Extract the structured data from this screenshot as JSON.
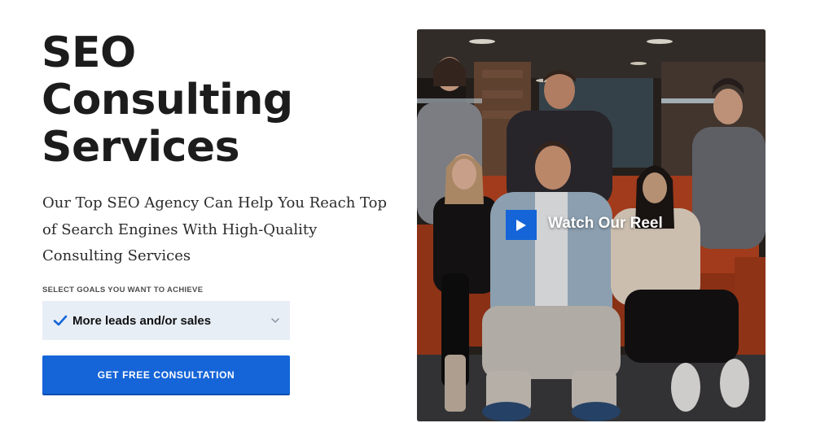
{
  "hero": {
    "title_lines": [
      "SEO",
      "Consulting",
      "Services"
    ],
    "subtitle": "Our Top SEO Agency Can Help You Reach Top of Search Engines With High-Quality Consulting Services"
  },
  "goals": {
    "label": "SELECT GOALS YOU WANT TO ACHIEVE",
    "selected": "More leads and/or sales",
    "icon": "checkmark-icon",
    "dropdown_icon": "chevron-down-icon"
  },
  "cta": {
    "label": "GET FREE CONSULTATION"
  },
  "video": {
    "label": "Watch Our Reel",
    "icon": "play-icon"
  },
  "colors": {
    "accent": "#1565d8",
    "select_bg": "#e8eef6",
    "text_dark": "#1c1c1c"
  }
}
